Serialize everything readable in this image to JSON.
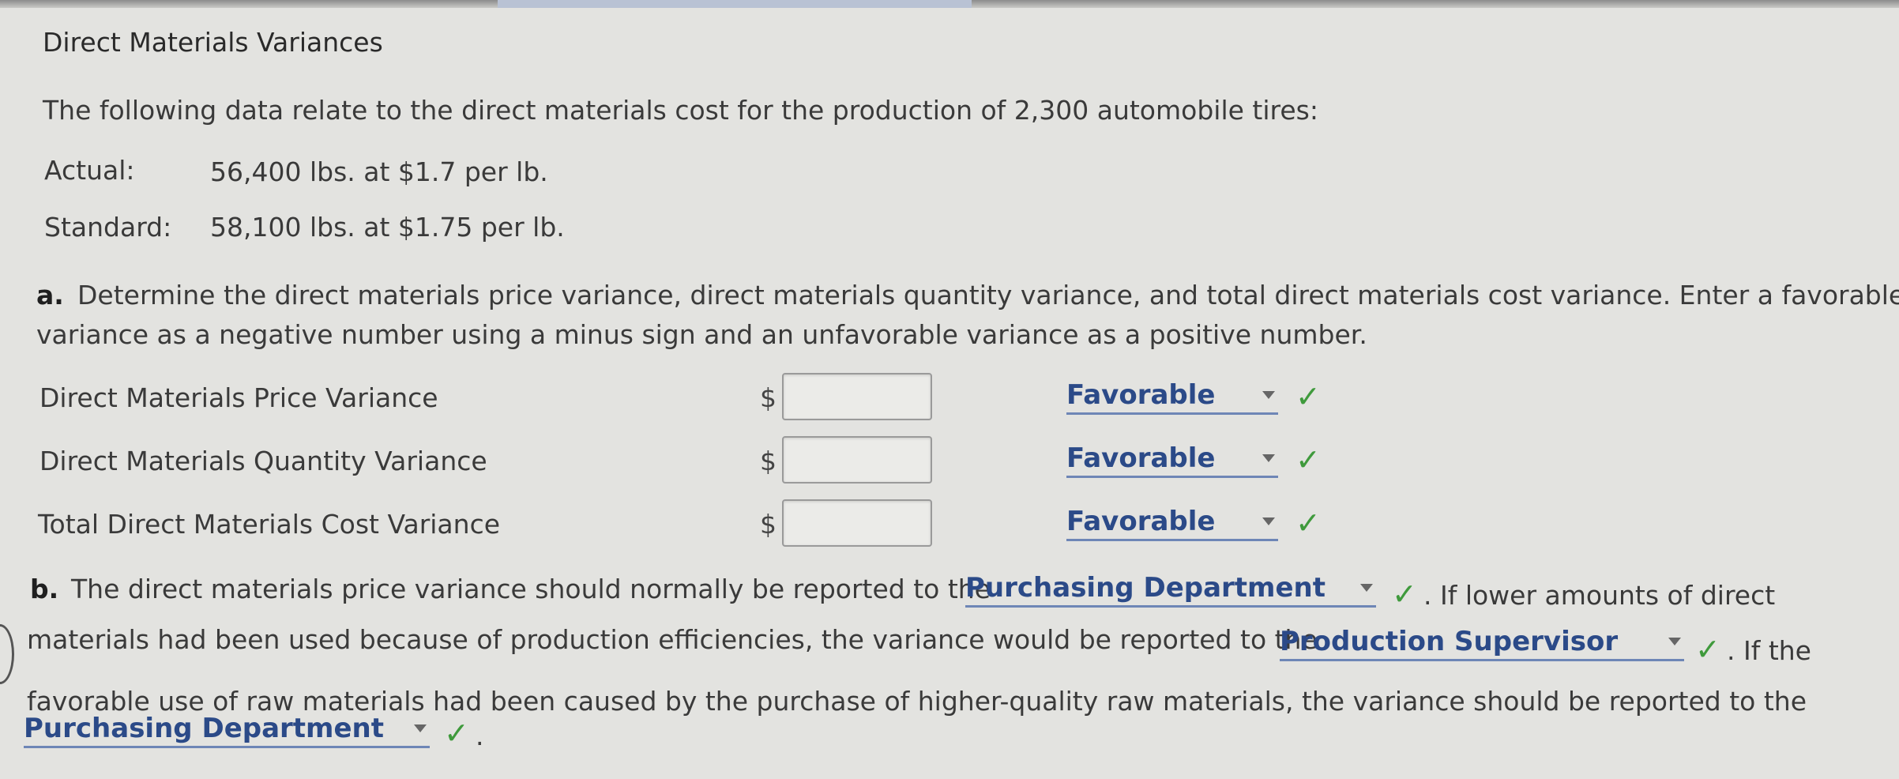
{
  "title": "Direct Materials Variances",
  "intro": "The following data relate to the direct materials cost for the production of 2,300 automobile tires:",
  "actual": {
    "label": "Actual:",
    "value": "56,400 lbs. at $1.7 per lb."
  },
  "standard": {
    "label": "Standard:",
    "value": "58,100 lbs. at $1.75 per lb."
  },
  "part_a": {
    "label": "a.",
    "line1": "Determine the direct materials price variance, direct materials quantity variance, and total direct materials cost variance. Enter a favorable",
    "line2": "variance as a negative number using a minus sign and an unfavorable variance as a positive number.",
    "rows": [
      {
        "label": "Direct Materials Price Variance",
        "currency": "$",
        "amount": "",
        "selection": "Favorable"
      },
      {
        "label": "Direct Materials Quantity Variance",
        "currency": "$",
        "amount": "",
        "selection": "Favorable"
      },
      {
        "label": "Total Direct Materials Cost Variance",
        "currency": "$",
        "amount": "",
        "selection": "Favorable"
      }
    ]
  },
  "part_b": {
    "label": "b.",
    "text1": "The direct materials price variance should normally be reported to the",
    "select1": "Purchasing Department",
    "text2": ". If lower amounts of direct",
    "text3": "materials had been used because of production efficiencies, the variance would be reported to the",
    "select2": "Production Supervisor",
    "text4": ". If the",
    "text5": "favorable use of raw materials had been caused by the purchase of higher-quality raw materials, the variance should be reported to the",
    "select3": "Purchasing Department",
    "text6": "."
  },
  "check_glyph": "✓",
  "colors": {
    "select_text": "#2b4a88",
    "check": "#3f9a3c",
    "background": "#e3e3e0"
  }
}
